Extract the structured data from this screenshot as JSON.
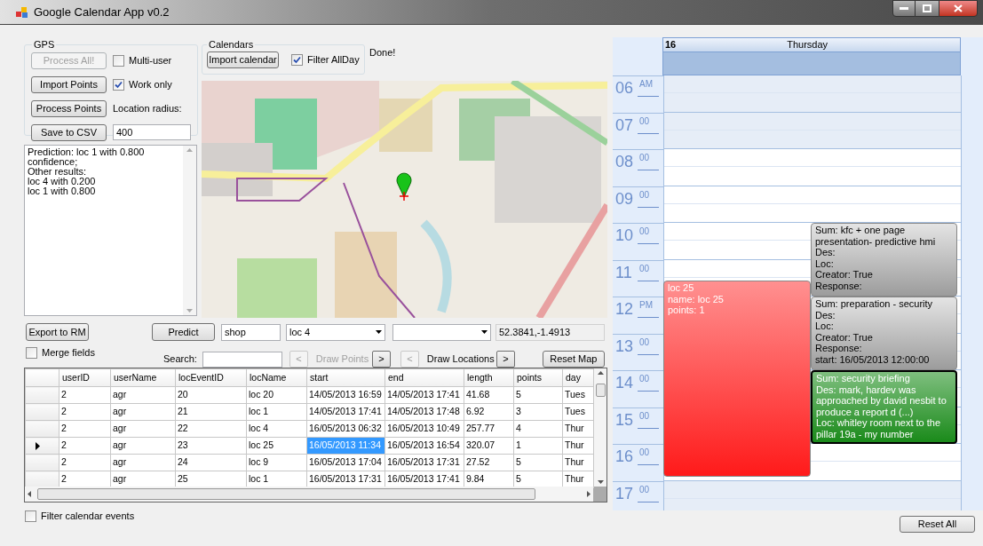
{
  "window": {
    "title": "Google Calendar App v0.2"
  },
  "gps": {
    "title": "GPS",
    "buttons": [
      {
        "label": "Process All!",
        "disabled": true
      },
      {
        "label": "Import Points",
        "disabled": false
      },
      {
        "label": "Process Points",
        "disabled": false
      },
      {
        "label": "Save to CSV",
        "disabled": false
      }
    ],
    "checkboxes": [
      {
        "label": "Multi-user",
        "checked": false
      },
      {
        "label": "Work only",
        "checked": true
      }
    ],
    "radius_label": "Location radius:",
    "radius_value": "400"
  },
  "calendars": {
    "title": "Calendars",
    "import_button": "Import calendar",
    "filter_allday": {
      "label": "Filter AllDay",
      "checked": true
    }
  },
  "status": "Done!",
  "prediction_text": [
    "Prediction: loc 1 with 0.800 confidence;",
    "Other results:",
    "loc 4 with 0.200",
    "loc 1 with 0.800"
  ],
  "predict_row": {
    "export_button": "Export to RM",
    "predict_button": "Predict",
    "category_value": "shop",
    "location_combo": "loc 4",
    "coordinates": "52.3841,-1.4913"
  },
  "merge_fields": {
    "label": "Merge fields",
    "checked": false
  },
  "search": {
    "label": "Search:",
    "draw_groups": [
      {
        "prev": "<",
        "prev_disabled": true,
        "label": "Draw Points",
        "label_disabled": true,
        "next": ">",
        "next_disabled": false
      },
      {
        "prev": "<",
        "prev_disabled": true,
        "label": "Draw Locations",
        "label_disabled": false,
        "next": ">",
        "next_disabled": false
      }
    ],
    "reset_map": "Reset Map"
  },
  "table": {
    "columns": [
      "userID",
      "userName",
      "locEventID",
      "locName",
      "start",
      "end",
      "length",
      "points",
      "day"
    ],
    "rows": [
      {
        "current": false,
        "cells": [
          {
            "text": "2",
            "selected": false
          },
          {
            "text": "agr",
            "selected": false
          },
          {
            "text": "20",
            "selected": false
          },
          {
            "text": "loc 20",
            "selected": false
          },
          {
            "text": "14/05/2013 16:59",
            "selected": false
          },
          {
            "text": "14/05/2013 17:41",
            "selected": false
          },
          {
            "text": "41.68",
            "selected": false
          },
          {
            "text": "5",
            "selected": false
          },
          {
            "text": "Tues",
            "selected": false
          }
        ]
      },
      {
        "current": false,
        "cells": [
          {
            "text": "2",
            "selected": false
          },
          {
            "text": "agr",
            "selected": false
          },
          {
            "text": "21",
            "selected": false
          },
          {
            "text": "loc 1",
            "selected": false
          },
          {
            "text": "14/05/2013 17:41",
            "selected": false
          },
          {
            "text": "14/05/2013 17:48",
            "selected": false
          },
          {
            "text": "6.92",
            "selected": false
          },
          {
            "text": "3",
            "selected": false
          },
          {
            "text": "Tues",
            "selected": false
          }
        ]
      },
      {
        "current": false,
        "cells": [
          {
            "text": "2",
            "selected": false
          },
          {
            "text": "agr",
            "selected": false
          },
          {
            "text": "22",
            "selected": false
          },
          {
            "text": "loc 4",
            "selected": false
          },
          {
            "text": "16/05/2013 06:32",
            "selected": false
          },
          {
            "text": "16/05/2013 10:49",
            "selected": false
          },
          {
            "text": "257.77",
            "selected": false
          },
          {
            "text": "4",
            "selected": false
          },
          {
            "text": "Thur",
            "selected": false
          }
        ]
      },
      {
        "current": true,
        "cells": [
          {
            "text": "2",
            "selected": false
          },
          {
            "text": "agr",
            "selected": false
          },
          {
            "text": "23",
            "selected": false
          },
          {
            "text": "loc 25",
            "selected": false
          },
          {
            "text": "16/05/2013 11:34",
            "selected": true
          },
          {
            "text": "16/05/2013 16:54",
            "selected": false
          },
          {
            "text": "320.07",
            "selected": false
          },
          {
            "text": "1",
            "selected": false
          },
          {
            "text": "Thur",
            "selected": false
          }
        ]
      },
      {
        "current": false,
        "cells": [
          {
            "text": "2",
            "selected": false
          },
          {
            "text": "agr",
            "selected": false
          },
          {
            "text": "24",
            "selected": false
          },
          {
            "text": "loc 9",
            "selected": false
          },
          {
            "text": "16/05/2013 17:04",
            "selected": false
          },
          {
            "text": "16/05/2013 17:31",
            "selected": false
          },
          {
            "text": "27.52",
            "selected": false
          },
          {
            "text": "5",
            "selected": false
          },
          {
            "text": "Thur",
            "selected": false
          }
        ]
      },
      {
        "current": false,
        "cells": [
          {
            "text": "2",
            "selected": false
          },
          {
            "text": "agr",
            "selected": false
          },
          {
            "text": "25",
            "selected": false
          },
          {
            "text": "loc 1",
            "selected": false
          },
          {
            "text": "16/05/2013 17:31",
            "selected": false
          },
          {
            "text": "16/05/2013 17:41",
            "selected": false
          },
          {
            "text": "9.84",
            "selected": false
          },
          {
            "text": "5",
            "selected": false
          },
          {
            "text": "Thur",
            "selected": false
          }
        ]
      }
    ]
  },
  "filter_calendar_events": {
    "label": "Filter calendar events",
    "checked": false
  },
  "reset_all": "Reset All",
  "calendar": {
    "date": "16",
    "day": "Thursday",
    "hours": [
      {
        "hour": "06",
        "suffix": "AM",
        "work": false
      },
      {
        "hour": "07",
        "suffix": "00",
        "work": false
      },
      {
        "hour": "08",
        "suffix": "00",
        "work": true
      },
      {
        "hour": "09",
        "suffix": "00",
        "work": true
      },
      {
        "hour": "10",
        "suffix": "00",
        "work": true
      },
      {
        "hour": "11",
        "suffix": "00",
        "work": true
      },
      {
        "hour": "12",
        "suffix": "PM",
        "work": true
      },
      {
        "hour": "13",
        "suffix": "00",
        "work": true
      },
      {
        "hour": "14",
        "suffix": "00",
        "work": true
      },
      {
        "hour": "15",
        "suffix": "00",
        "work": true
      },
      {
        "hour": "16",
        "suffix": "00",
        "work": true
      },
      {
        "hour": "17",
        "suffix": "00",
        "work": false
      }
    ],
    "events": [
      {
        "kind": "location",
        "color": "#ff1a1a",
        "selected": false,
        "lines": [
          "loc 25",
          "name: loc 25",
          "points: 1"
        ]
      },
      {
        "kind": "appointment",
        "color": "#9c9c9c",
        "selected": false,
        "lines": [
          "Sum: kfc + one page presentation- predictive hmi",
          "Des:",
          "Loc:",
          "Creator: True",
          "Response:"
        ]
      },
      {
        "kind": "appointment",
        "color": "#9c9c9c",
        "selected": false,
        "lines": [
          "Sum: preparation - security",
          "Des:",
          "Loc:",
          "Creator: True",
          "Response:",
          "start: 16/05/2013 12:00:00"
        ]
      },
      {
        "kind": "appointment",
        "color": "#1a8a1a",
        "selected": true,
        "lines": [
          "Sum: security briefing",
          "Des: mark, hardev was approached by david nesbit to produce a report d (...)",
          "Loc: whitley room next to the pillar 19a - my number"
        ]
      }
    ]
  }
}
